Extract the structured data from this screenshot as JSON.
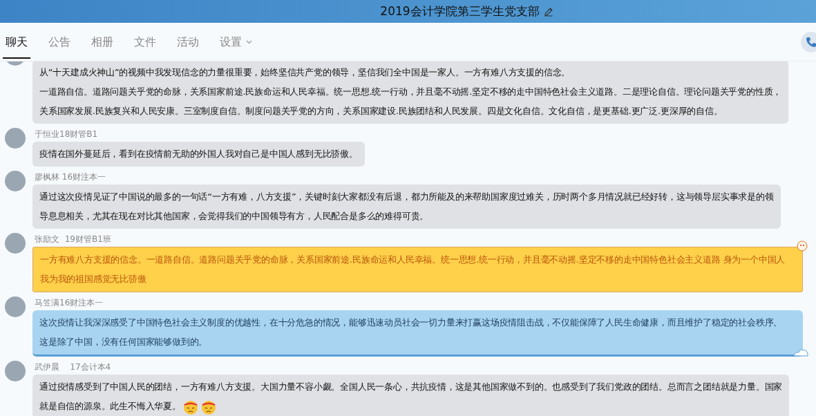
{
  "window": {
    "title": "2019会计学院第三学生党支部"
  },
  "tabs": [
    {
      "label": "聊天",
      "selected": true,
      "dropdown": false
    },
    {
      "label": "公告",
      "selected": false,
      "dropdown": false
    },
    {
      "label": "相册",
      "selected": false,
      "dropdown": false
    },
    {
      "label": "文件",
      "selected": false,
      "dropdown": false
    },
    {
      "label": "活动",
      "selected": false,
      "dropdown": false
    },
    {
      "label": "设置",
      "selected": false,
      "dropdown": true
    }
  ],
  "messages": [
    {
      "kind": "plain",
      "lines": [
        "从“十天建成火神山”的视频中我发现信念的力量很重要，始终坚信共产党的领导，坚信我们全中国是一家人。一方有难八方支援的信念。",
        "一道路自信。道路问题关乎党的命脉，关系国家前途.民族命运和人民幸福。统一思想.统一行动，并且毫不动摇.坚定不移的走中国特色社会主义道路。二是理论自信。理论问题关乎党的性质，",
        "关系国家发展.民族复兴和人民安康。三室制度自信。制度问题关乎党的方向，关系国家建设.民族团结和人民发展。四是文化自信。文化自信，是更基础.更广泛.更深厚的自信。"
      ]
    },
    {
      "kind": "plain",
      "name": "于恒业18财管B1",
      "lines": [
        "疫情在国外蔓延后，看到在疫情前无助的外国人我对自己是中国人感到无比骄傲。"
      ]
    },
    {
      "kind": "plain",
      "name": "廖枫林 16财注本一",
      "lines": [
        "通过这次疫情见证了中国说的最多的一句话“一方有难，八方支援”，关键时刻大家都没有后退，都力所能及的来帮助国家度过难关，历时两个多月情况就已经好转，这与领导层实事求是的领",
        "导息息相关，尤其在现在对比其他国家，会觉得我们的中国领导有方，人民配合是多么的难得可贵。"
      ]
    },
    {
      "kind": "yellow",
      "name": "张励文  19财管B1班",
      "lines": [
        "一方有难八方支援的信念。一道路自信。道路问题关乎党的命脉，关系国家前途.民族命运和人民幸福。统一思想.统一行动，并且毫不动摇.坚定不移的走中国特色社会主义道路 身为一个中国人",
        "我为我的祖国感觉无比骄傲"
      ]
    },
    {
      "kind": "blue",
      "name": "马笠满16财注本一",
      "lines": [
        "这次疫情让我深深感受了中国特色社会主义制度的优越性，在十分危急的情况，能够迅速动员社会一切力量来打赢这场疫情阻击战，不仅能保障了人民生命健康，而且维护了稳定的社会秩序。",
        "这是除了中国，没有任何国家能够做到的。"
      ]
    },
    {
      "kind": "plain",
      "name": "武伊晨    17会计本4",
      "lines": [
        "通过疫情感受到了中国人民的团结，一方有难八方支援。大国力量不容小觑。全国人民一条心，共抗疫情，这是其他国家做不到的。也感受到了我们党政的团结。总而言之团结就是力量。国家",
        "就是自信的源泉。此生不悔入华夏。"
      ],
      "emojis": [
        {
          "kind": "headband-face"
        },
        {
          "kind": "headband-face"
        }
      ]
    }
  ]
}
